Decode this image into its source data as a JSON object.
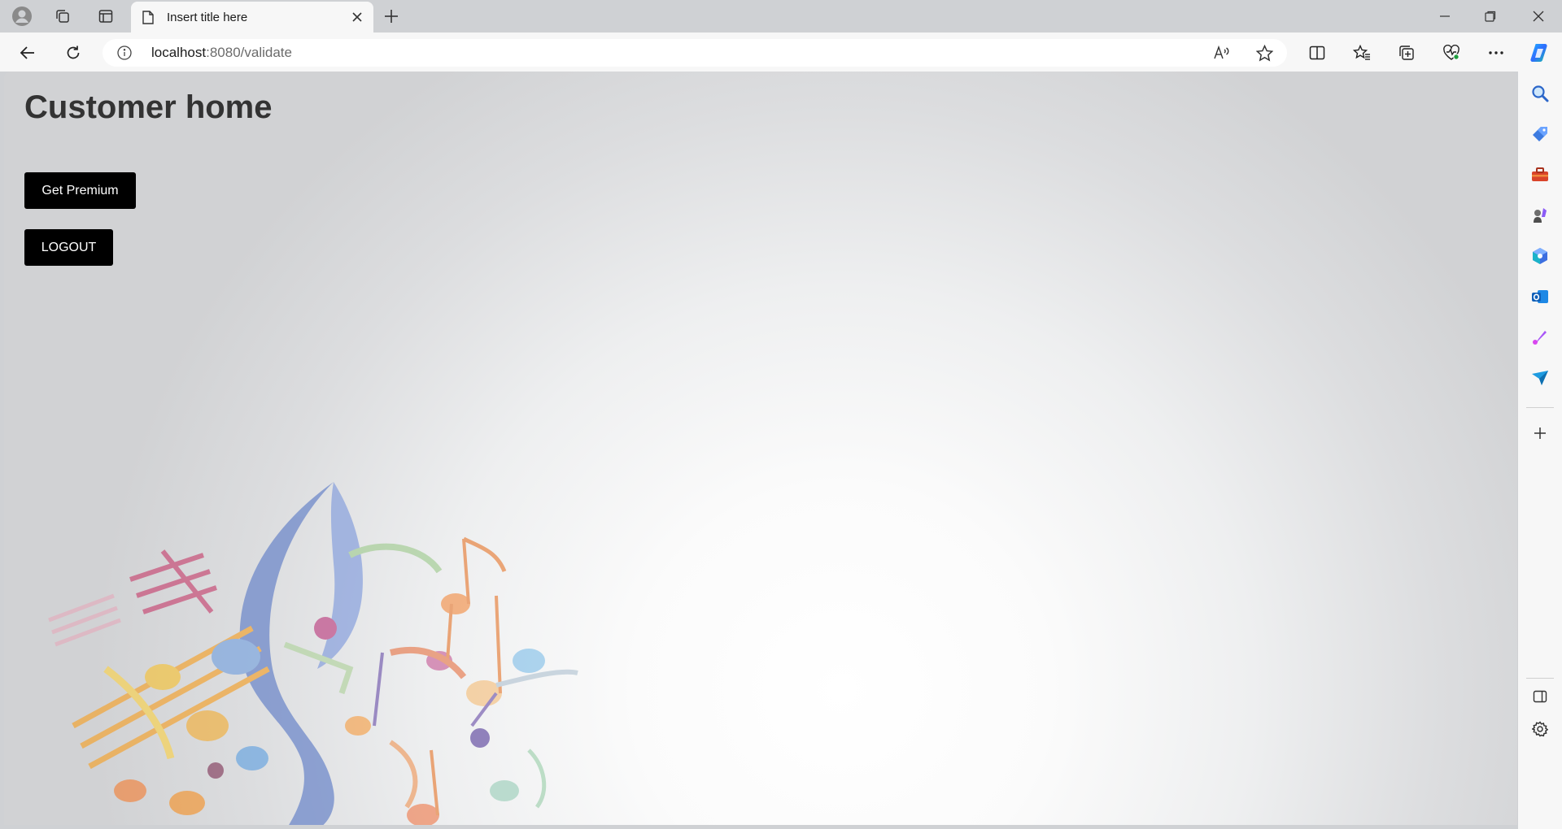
{
  "browser": {
    "tab": {
      "title": "Insert title here"
    },
    "address_bar": {
      "host": "localhost",
      "path": ":8080/validate"
    }
  },
  "page": {
    "heading": "Customer home",
    "buttons": {
      "get_premium": "Get Premium",
      "logout": "LOGOUT"
    }
  },
  "colors": {
    "button_bg": "#000000",
    "button_text": "#ffffff",
    "heading_text": "#333333",
    "chrome_bg": "#cfd1d4",
    "toolbar_bg": "#f7f7f7"
  },
  "icons": {
    "tabstrip": [
      "profile-icon",
      "workspaces-icon",
      "vertical-tabs-icon",
      "page-icon",
      "close-tab-icon",
      "new-tab-icon"
    ],
    "window": [
      "minimize-icon",
      "restore-icon",
      "close-window-icon"
    ],
    "toolbar": [
      "back-icon",
      "refresh-icon",
      "site-info-icon",
      "read-aloud-icon",
      "favorite-star-icon",
      "split-screen-icon",
      "favorites-icon",
      "collections-icon",
      "browser-essentials-icon",
      "more-icon",
      "copilot-icon"
    ],
    "sidebar": [
      "search-icon",
      "shopping-icon",
      "tools-icon",
      "games-icon",
      "microsoft365-icon",
      "outlook-icon",
      "designer-icon",
      "send-icon",
      "add-icon",
      "hide-sidebar-icon",
      "settings-icon"
    ]
  }
}
